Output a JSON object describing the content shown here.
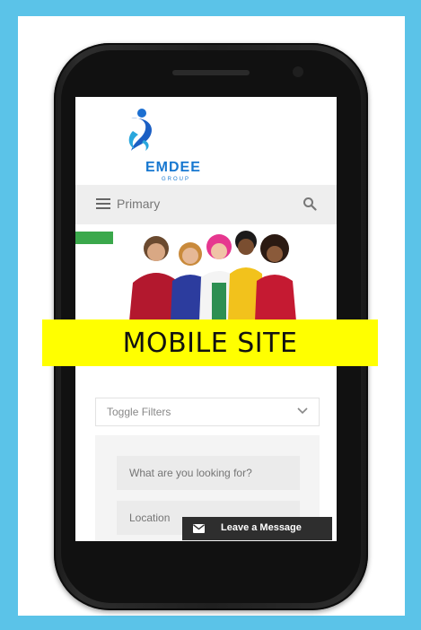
{
  "overlay": {
    "label": "MOBILE SITE"
  },
  "site": {
    "logo_text": "EMDEE",
    "logo_sub": "GROUP"
  },
  "navbar": {
    "label": "Primary"
  },
  "filters": {
    "label": "Toggle Filters"
  },
  "search": {
    "keyword_placeholder": "What are you looking for?",
    "location_placeholder": "Location"
  },
  "message_bar": {
    "label": "Leave a Message"
  },
  "colors": {
    "background": "#5bc3e8",
    "overlay": "#ffff00",
    "badge": "#3aa84b",
    "brand": "#1878d0"
  },
  "icons": {
    "menu": "hamburger-icon",
    "search": "search-icon",
    "chevron": "chevron-down-icon",
    "envelope": "envelope-icon"
  }
}
